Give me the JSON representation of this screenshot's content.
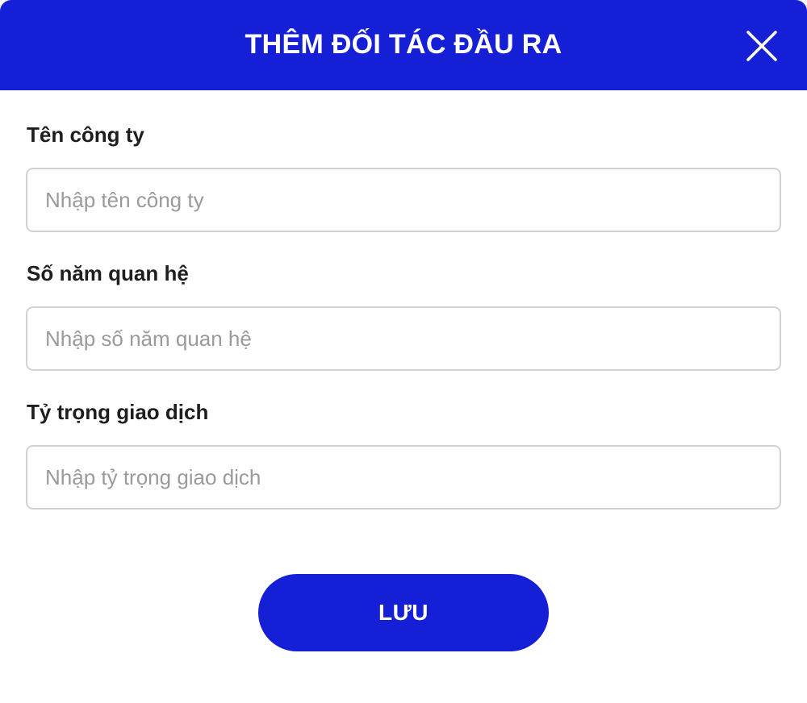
{
  "dialog": {
    "title": "THÊM ĐỐI TÁC ĐẦU RA",
    "close_icon": "close-icon",
    "colors": {
      "primary": "#1520D6",
      "label": "#1e1e1e",
      "placeholder": "#9a9a9a",
      "border": "#d2d2d2"
    }
  },
  "form": {
    "company_name": {
      "label": "Tên công ty",
      "value": "",
      "placeholder": "Nhập tên công ty"
    },
    "years_relationship": {
      "label": "Số năm quan hệ",
      "value": "",
      "placeholder": "Nhập số năm quan hệ"
    },
    "transaction_share": {
      "label": "Tỷ trọng giao dịch",
      "value": "",
      "placeholder": "Nhập tỷ trọng giao dịch"
    }
  },
  "actions": {
    "save_label": "LƯU"
  }
}
